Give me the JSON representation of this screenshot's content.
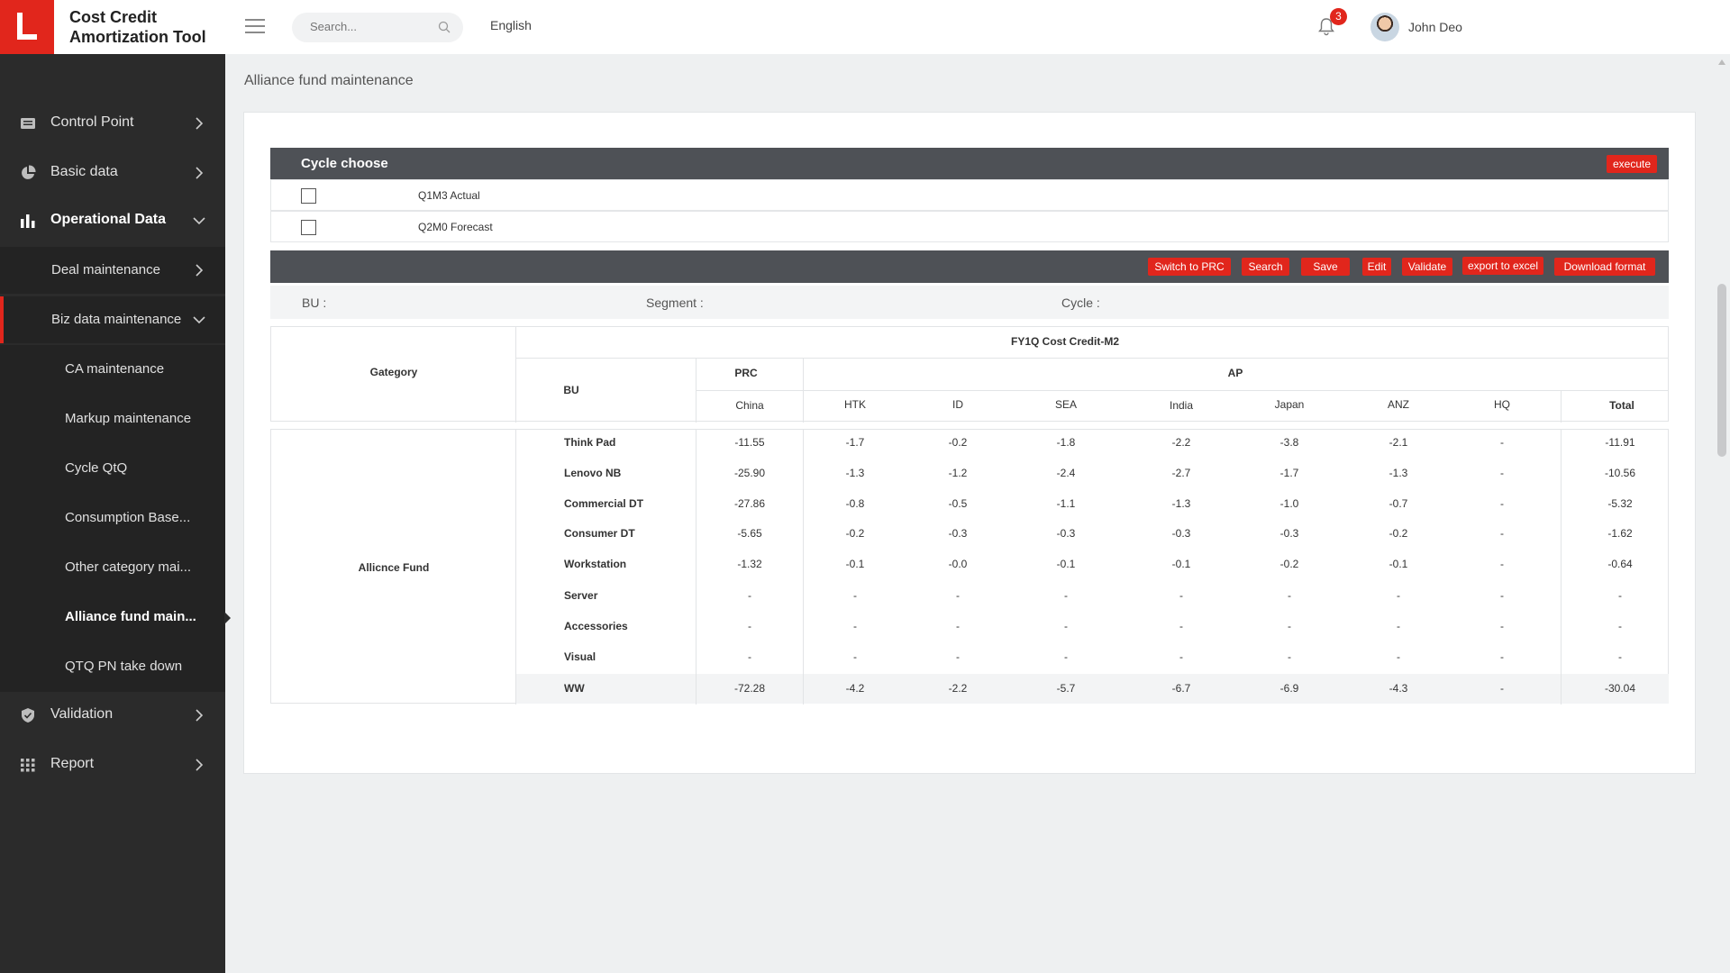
{
  "app": {
    "title_line1": "Cost Credit",
    "title_line2": "Amortization Tool"
  },
  "header": {
    "search_placeholder": "Search...",
    "language": "English",
    "notification_count": "3",
    "user_name": "John Deo"
  },
  "sidebar": {
    "control_point": "Control Point",
    "basic_data": "Basic data",
    "operational_data": "Operational Data",
    "deal_maintenance": "Deal maintenance",
    "biz_data_maintenance": "Biz data maintenance",
    "leaves": [
      "CA maintenance",
      "Markup maintenance",
      "Cycle QtQ",
      "Consumption Base...",
      "Other category mai...",
      "Alliance fund main...",
      "QTQ PN take down"
    ],
    "validation": "Validation",
    "report": "Report"
  },
  "page": {
    "title": "Alliance fund maintenance"
  },
  "cycle": {
    "title": "Cycle choose",
    "execute": "execute",
    "options": [
      "Q1M3 Actual",
      "Q2M0 Forecast"
    ]
  },
  "toolbar": {
    "switch_prc": "Switch to PRC",
    "search": "Search",
    "save": "Save",
    "edit": "Edit",
    "validate": "Validate",
    "export_excel": "export to excel",
    "download_format": "Download format"
  },
  "filters": {
    "bu": "BU :",
    "segment": "Segment :",
    "cycle": "Cycle :"
  },
  "table": {
    "category_header": "Gategory",
    "title": "FY1Q Cost Credit-M2",
    "bu_header": "BU",
    "prc_header": "PRC",
    "ap_header": "AP",
    "columns": [
      "China",
      "HTK",
      "ID",
      "SEA",
      "India",
      "Japan",
      "ANZ",
      "HQ",
      "Total"
    ],
    "category": "Allicnce Fund",
    "rows": [
      {
        "bu": "Think Pad",
        "values": [
          "-11.55",
          "-1.7",
          "-0.2",
          "-1.8",
          "-2.2",
          "-3.8",
          "-2.1",
          "-",
          "-11.91"
        ]
      },
      {
        "bu": "Lenovo NB",
        "values": [
          "-25.90",
          "-1.3",
          "-1.2",
          "-2.4",
          "-2.7",
          "-1.7",
          "-1.3",
          "-",
          "-10.56"
        ]
      },
      {
        "bu": "Commercial DT",
        "values": [
          "-27.86",
          "-0.8",
          "-0.5",
          "-1.1",
          "-1.3",
          "-1.0",
          "-0.7",
          "-",
          "-5.32"
        ]
      },
      {
        "bu": "Consumer DT",
        "values": [
          "-5.65",
          "-0.2",
          "-0.3",
          "-0.3",
          "-0.3",
          "-0.3",
          "-0.2",
          "-",
          "-1.62"
        ]
      },
      {
        "bu": "Workstation",
        "values": [
          "-1.32",
          "-0.1",
          "-0.0",
          "-0.1",
          "-0.1",
          "-0.2",
          "-0.1",
          "-",
          "-0.64"
        ]
      },
      {
        "bu": "Server",
        "values": [
          "-",
          "-",
          "-",
          "-",
          "-",
          "-",
          "-",
          "-",
          "-"
        ]
      },
      {
        "bu": "Accessories",
        "values": [
          "-",
          "-",
          "-",
          "-",
          "-",
          "-",
          "-",
          "-",
          "-"
        ]
      },
      {
        "bu": "Visual",
        "values": [
          "-",
          "-",
          "-",
          "-",
          "-",
          "-",
          "-",
          "-",
          "-"
        ]
      },
      {
        "bu": "WW",
        "values": [
          "-72.28",
          "-4.2",
          "-2.2",
          "-5.7",
          "-6.7",
          "-6.9",
          "-4.3",
          "-",
          "-30.04"
        ]
      }
    ]
  },
  "colors": {
    "accent": "#e1261c",
    "sidebar": "#2b2b2b",
    "toolbar": "#4e5156"
  }
}
